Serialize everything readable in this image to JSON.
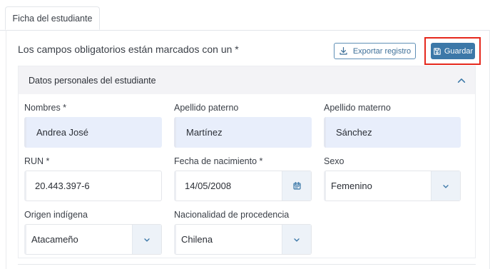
{
  "tabs": [
    {
      "label": "Ficha del estudiante"
    }
  ],
  "required_note": "Los campos obligatorios están marcados con un *",
  "toolbar": {
    "export_label": "Exportar registro",
    "save_label": "Guardar"
  },
  "section": {
    "title": "Datos personales del estudiante",
    "fields": {
      "nombres": {
        "label": "Nombres *",
        "value": "Andrea José"
      },
      "apellido_paterno": {
        "label": "Apellido paterno",
        "value": "Martínez"
      },
      "apellido_materno": {
        "label": "Apellido materno",
        "value": "Sánchez"
      },
      "run": {
        "label": "RUN *",
        "value": "20.443.397-6"
      },
      "fecha_nacimiento": {
        "label": "Fecha de nacimiento *",
        "value": "14/05/2008"
      },
      "sexo": {
        "label": "Sexo",
        "value": "Femenino"
      },
      "origen_indigena": {
        "label": "Origen indígena",
        "value": "Atacameño"
      },
      "nacionalidad": {
        "label": "Nacionalidad de procedencia",
        "value": "Chilena"
      }
    }
  },
  "icons": {
    "export": "download-icon",
    "save": "floppy-disk-icon",
    "collapse": "chevron-up-icon",
    "calendar": "calendar-icon",
    "dropdown": "chevron-down-icon"
  },
  "colors": {
    "primary": "#3c78a8",
    "highlight_border": "#e5281d",
    "filled_input": "#e8eefb",
    "section_header": "#f3f3f6"
  }
}
